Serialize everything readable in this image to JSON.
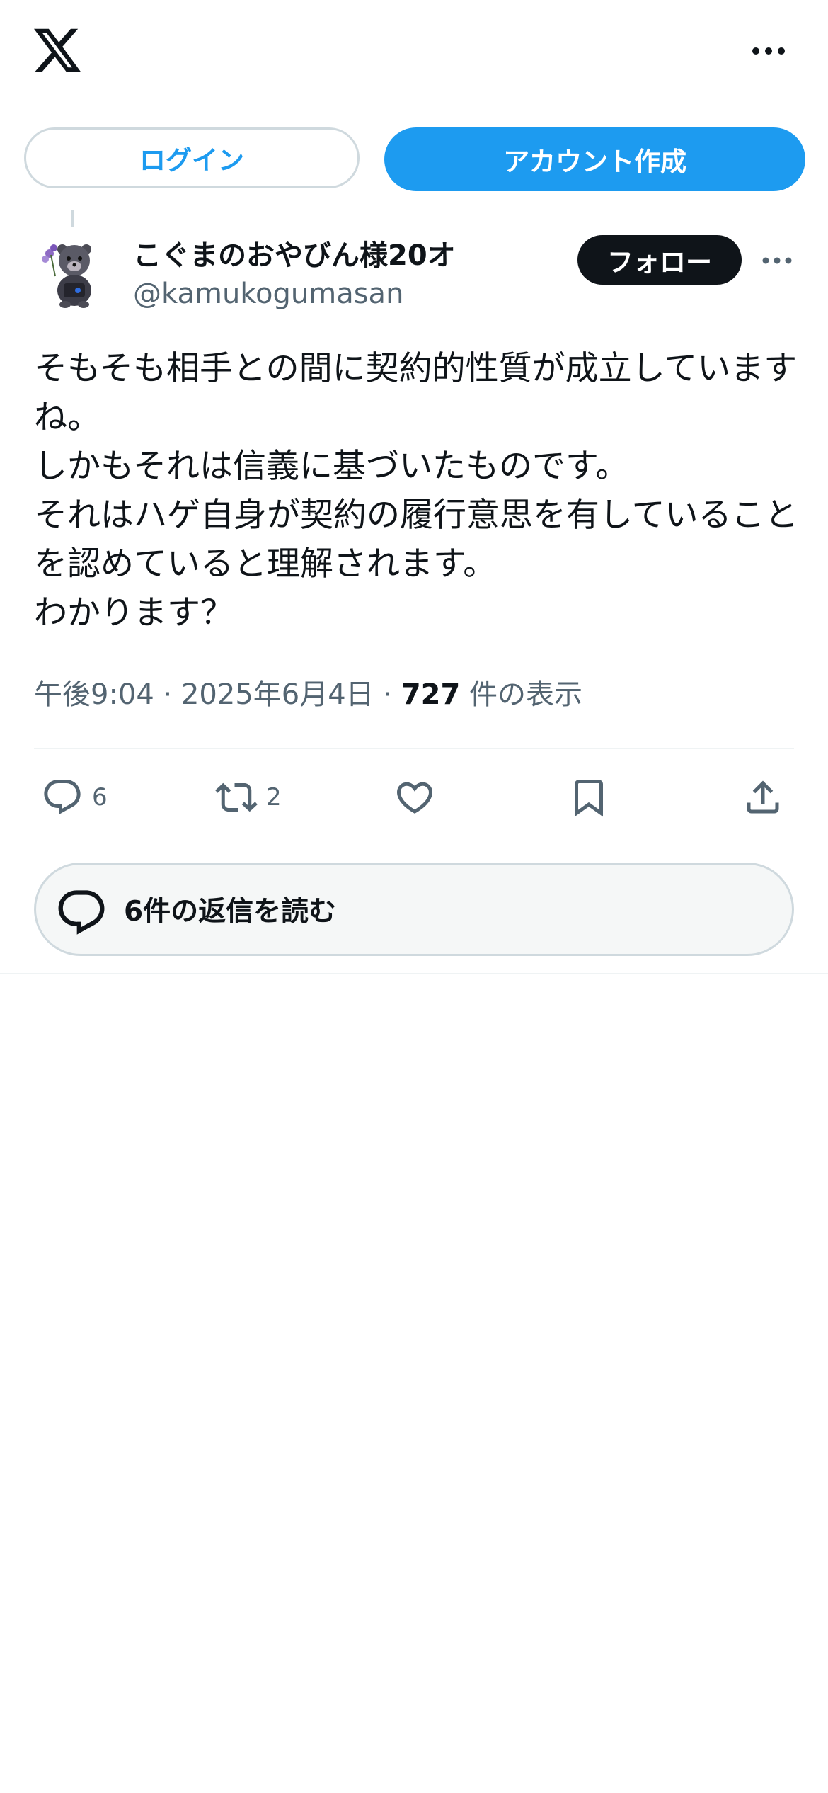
{
  "header": {
    "logo_icon": "x-logo-icon",
    "more_icon": "more-horizontal-icon"
  },
  "auth": {
    "login_label": "ログイン",
    "signup_label": "アカウント作成"
  },
  "post": {
    "author": {
      "display_name": "こぐまのおやびん様20オ",
      "handle": "@kamukogumasan"
    },
    "follow_label": "フォロー",
    "text": "そもそも相手との間に契約的性質が成立していますね。\nしかもそれは信義に基づいたものです。\nそれはハゲ自身が契約の履行意思を有していることを認めていると理解されます。\nわかります？",
    "time": "午後9:04",
    "sep": " · ",
    "date": "2025年6月4日",
    "views_count": "727",
    "views_label": " 件の表示",
    "actions": {
      "reply_count": "6",
      "repost_count": "2"
    }
  },
  "replies": {
    "read_label": "6件の返信を読む"
  },
  "colors": {
    "accent": "#1d9bf0",
    "text_primary": "#0f1419",
    "text_secondary": "#536471",
    "border": "#cfd9de"
  }
}
